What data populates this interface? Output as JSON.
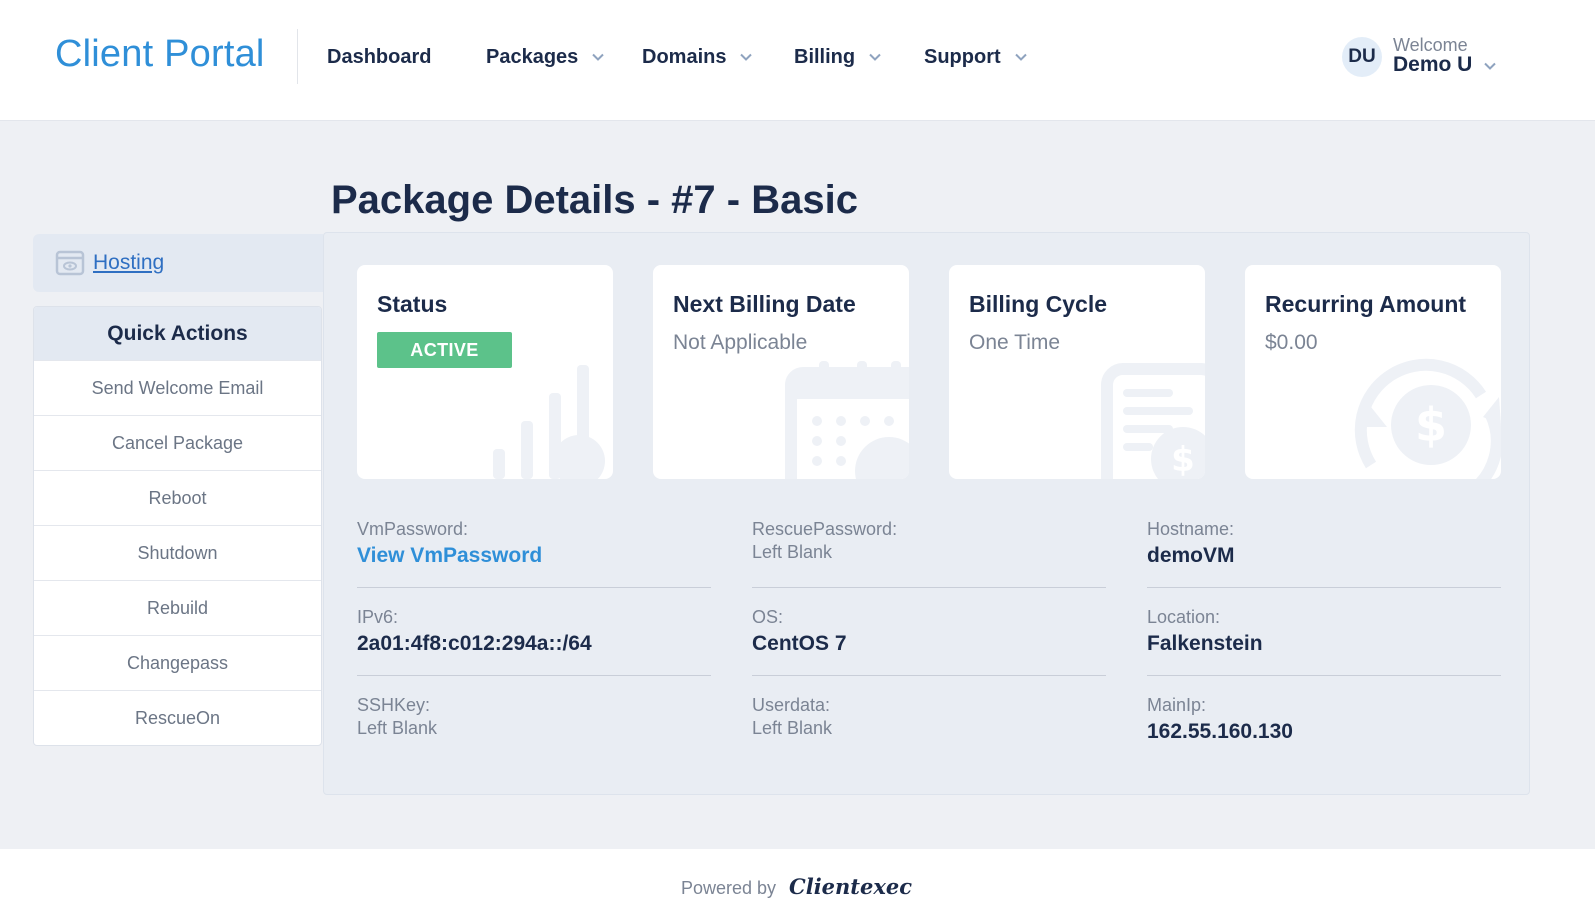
{
  "header": {
    "brand": "Client Portal",
    "nav": [
      {
        "label": "Dashboard",
        "has_menu": false
      },
      {
        "label": "Packages",
        "has_menu": true
      },
      {
        "label": "Domains",
        "has_menu": true
      },
      {
        "label": "Billing",
        "has_menu": true
      },
      {
        "label": "Support",
        "has_menu": true
      }
    ],
    "user": {
      "initials": "DU",
      "welcome": "Welcome",
      "name": "Demo U"
    }
  },
  "page": {
    "title": "Package Details - #7 - Basic"
  },
  "sidebar": {
    "hosting_label": " Hosting",
    "quick_actions_title": "Quick Actions",
    "actions": [
      "Send Welcome Email",
      "Cancel Package",
      "Reboot",
      "Shutdown",
      "Rebuild",
      "Changepass",
      "RescueOn"
    ]
  },
  "cards": [
    {
      "title": "Status",
      "badge": "ACTIVE",
      "icon": "chart-icon"
    },
    {
      "title": "Next Billing Date",
      "value": "Not Applicable",
      "icon": "calendar-icon"
    },
    {
      "title": "Billing Cycle",
      "value": "One Time",
      "icon": "invoice-icon"
    },
    {
      "title": "Recurring Amount",
      "value": "$0.00",
      "icon": "recurring-dollar-icon"
    }
  ],
  "details": [
    {
      "label": "VmPassword:",
      "value": "View VmPassword",
      "style": "link"
    },
    {
      "label": "RescuePassword:",
      "value": "Left Blank",
      "style": "plain"
    },
    {
      "label": "Hostname:",
      "value": "demoVM",
      "style": "bold"
    },
    {
      "label": "IPv6:",
      "value": "2a01:4f8:c012:294a::/64",
      "style": "bold"
    },
    {
      "label": "OS:",
      "value": "CentOS 7",
      "style": "bold"
    },
    {
      "label": "Location:",
      "value": "Falkenstein",
      "style": "bold"
    },
    {
      "label": "SSHKey:",
      "value": "Left Blank",
      "style": "plain"
    },
    {
      "label": "Userdata:",
      "value": "Left Blank",
      "style": "plain"
    },
    {
      "label": "MainIp:",
      "value": "162.55.160.130",
      "style": "bold"
    }
  ],
  "footer": {
    "powered_by": "Powered by",
    "vendor": "Clientexec"
  },
  "colors": {
    "accent": "#2f8fd8",
    "active_badge": "#5cc28a",
    "text": "#1c2b4a",
    "muted": "#7b8494"
  }
}
